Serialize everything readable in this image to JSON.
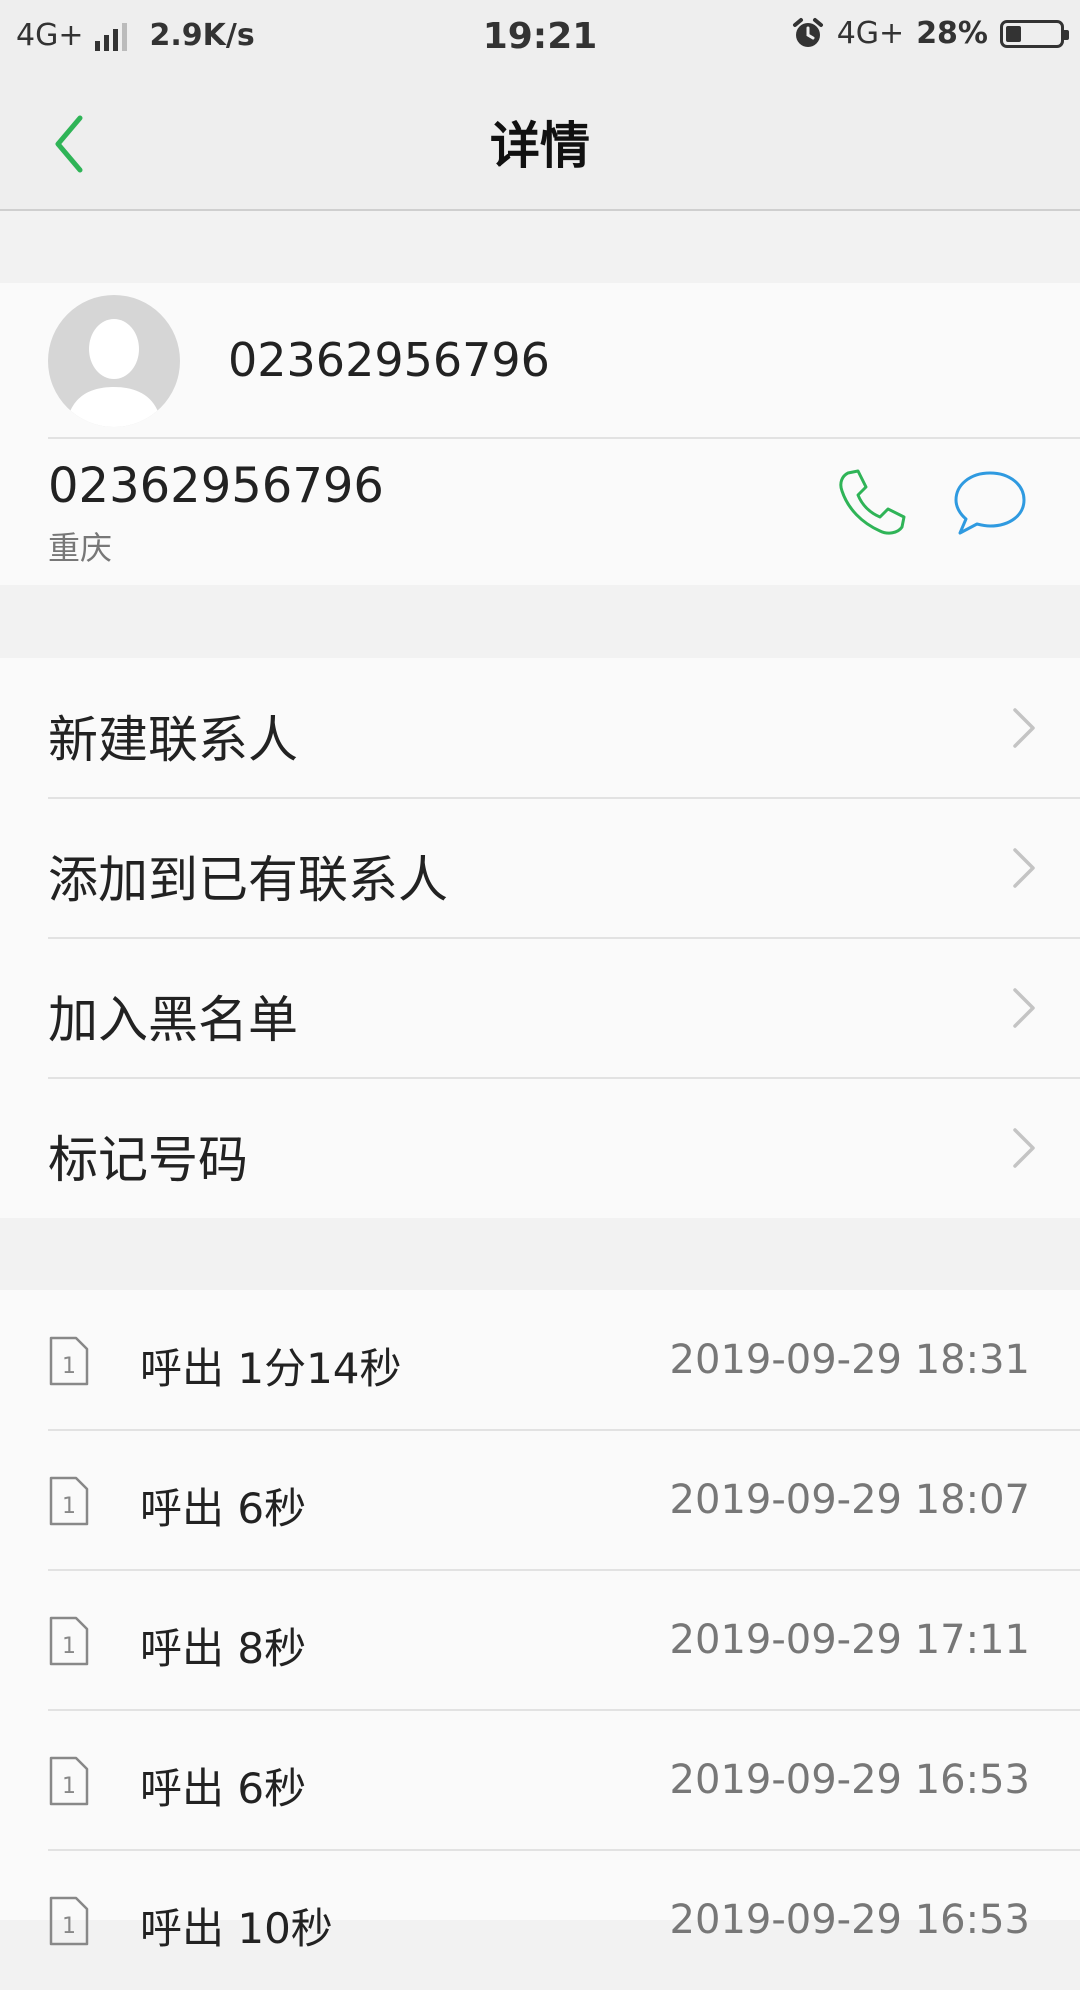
{
  "status_bar": {
    "network": "4G+",
    "speed": "2.9K/s",
    "time": "19:21",
    "network_right": "4G+",
    "battery_text": "28%",
    "battery_level": 0.28
  },
  "header": {
    "title": "详情",
    "back_icon": "chevron-left-icon",
    "accent_color": "#2fb457"
  },
  "contact": {
    "name": "02362956796",
    "number": "02362956796",
    "location": "重庆",
    "call_icon_color": "#2fb457",
    "message_icon_color": "#2f9ae0"
  },
  "actions": [
    {
      "label": "新建联系人"
    },
    {
      "label": "添加到已有联系人"
    },
    {
      "label": "加入黑名单"
    },
    {
      "label": "标记号码"
    }
  ],
  "call_log": [
    {
      "sim": "1",
      "type": "呼出 1分14秒",
      "time": "2019-09-29 18:31"
    },
    {
      "sim": "1",
      "type": "呼出 6秒",
      "time": "2019-09-29 18:07"
    },
    {
      "sim": "1",
      "type": "呼出 8秒",
      "time": "2019-09-29 17:11"
    },
    {
      "sim": "1",
      "type": "呼出 6秒",
      "time": "2019-09-29 16:53"
    },
    {
      "sim": "1",
      "type": "呼出 10秒",
      "time": "2019-09-29 16:53"
    }
  ]
}
